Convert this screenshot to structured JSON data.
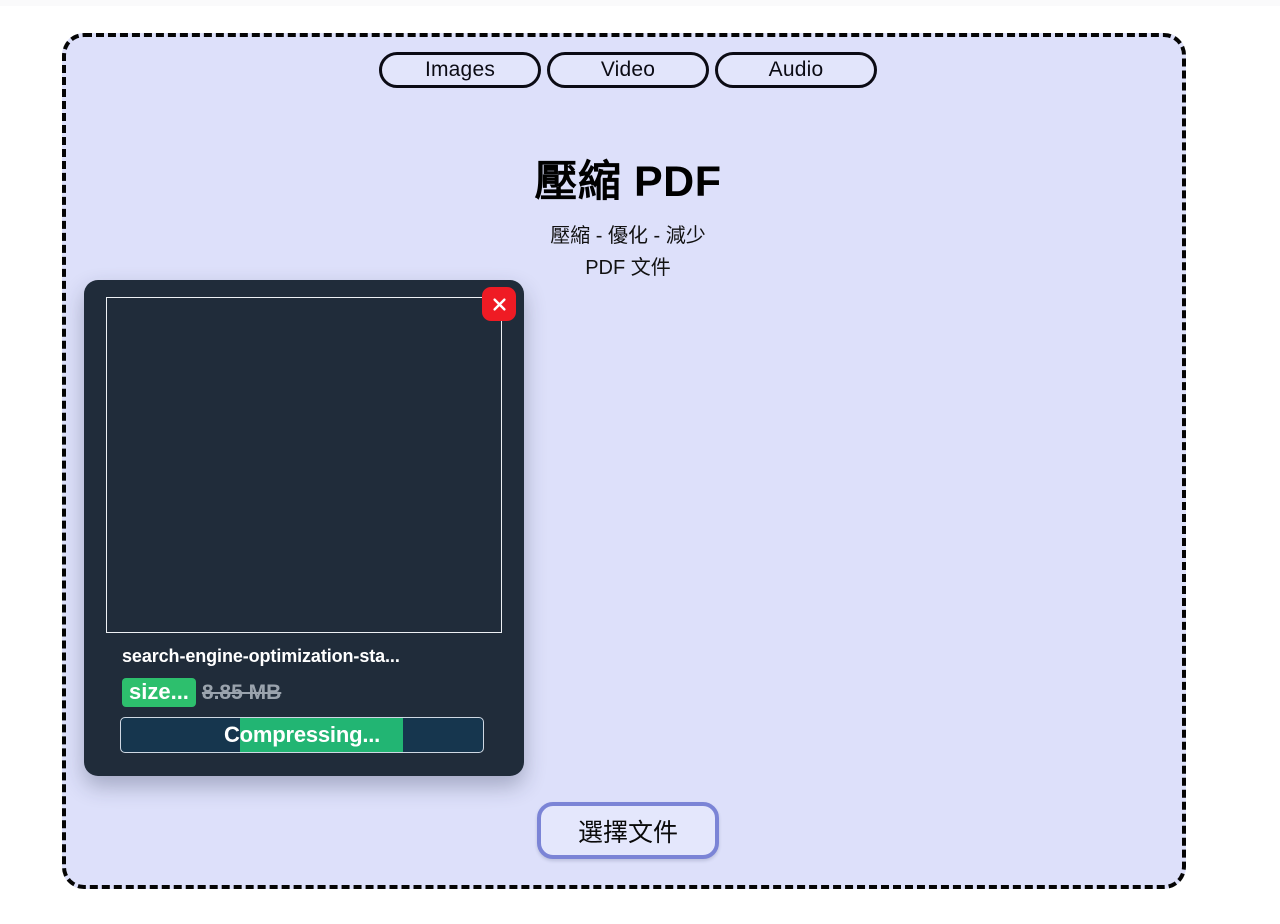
{
  "page": {
    "background_color": "#ffffff",
    "dropzone_color": "#dde0fa",
    "accent_color": "#7b84d6",
    "success_color": "#2dbf6d",
    "danger_color": "#ef1b24"
  },
  "tabs": [
    {
      "label": "Images",
      "name": "tab-images"
    },
    {
      "label": "Video",
      "name": "tab-video"
    },
    {
      "label": "Audio",
      "name": "tab-audio"
    }
  ],
  "header": {
    "title": "壓縮 PDF",
    "subtitle_line1": "壓縮 - 優化 - 減少",
    "subtitle_line2": "PDF 文件"
  },
  "file_card": {
    "file_name": "search-engine-optimization-sta...",
    "size_badge": "size...",
    "original_size": "8.85 MB",
    "progress_label": "Compressing...",
    "progress_percent": 78,
    "close_icon": "close-icon"
  },
  "actions": {
    "choose_file_label": "選擇文件"
  }
}
